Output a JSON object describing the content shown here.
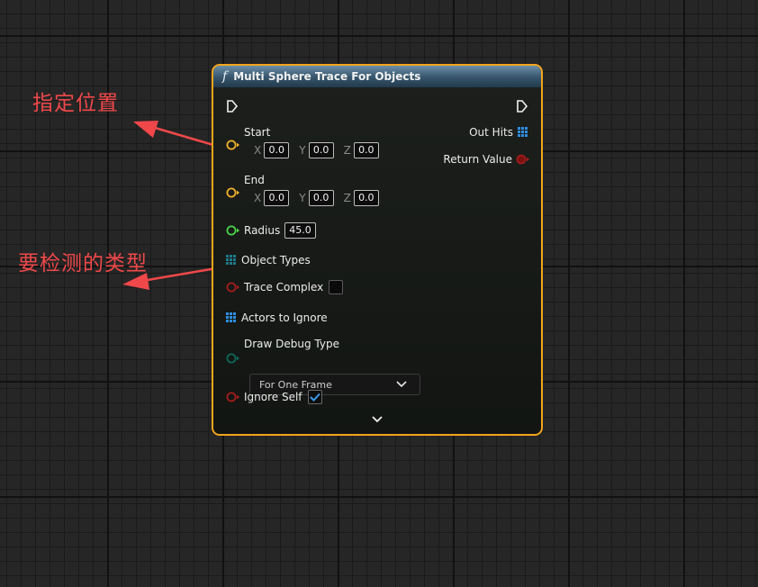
{
  "annotations": {
    "position_note": "指定位置",
    "type_note": "要检测的类型"
  },
  "node": {
    "function_glyph": "f",
    "title": "Multi Sphere Trace For Objects",
    "colors": {
      "border": "#f3a51c",
      "vector_pin": "#f3b22b",
      "float_pin": "#4bd64b",
      "bool_pin": "#a51c1c",
      "array_pin": "#2f8ee0",
      "object_types_pin": "#1e7a8a",
      "enum_pin": "#0e6a5a",
      "checkmark": "#3b9cf0"
    },
    "inputs": {
      "start": {
        "label": "Start",
        "x_label": "X",
        "x": "0.0",
        "y_label": "Y",
        "y": "0.0",
        "z_label": "Z",
        "z": "0.0"
      },
      "end": {
        "label": "End",
        "x_label": "X",
        "x": "0.0",
        "y_label": "Y",
        "y": "0.0",
        "z_label": "Z",
        "z": "0.0"
      },
      "radius": {
        "label": "Radius",
        "value": "45.0"
      },
      "object_types": {
        "label": "Object Types"
      },
      "trace_complex": {
        "label": "Trace Complex",
        "checked": false
      },
      "actors_to_ignore": {
        "label": "Actors to Ignore"
      },
      "draw_debug_type": {
        "label": "Draw Debug Type",
        "selected": "For One Frame"
      },
      "ignore_self": {
        "label": "Ignore Self",
        "checked": true
      }
    },
    "outputs": {
      "out_hits": {
        "label": "Out Hits"
      },
      "return_value": {
        "label": "Return Value"
      }
    },
    "icons": {
      "exec_in": "exec-pin-icon",
      "exec_out": "exec-pin-icon",
      "expand": "chevron-down-icon"
    }
  }
}
